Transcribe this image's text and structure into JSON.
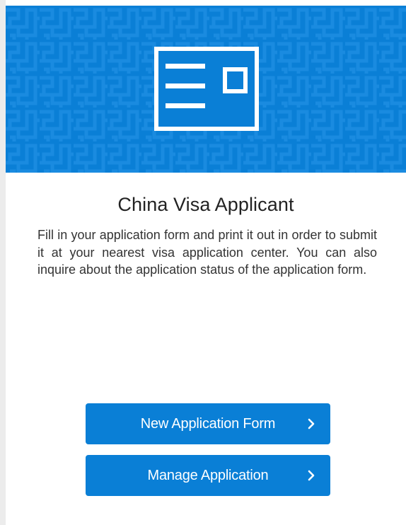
{
  "header": {
    "icon": "id-card-icon",
    "background_color": "#0a7fd6"
  },
  "main": {
    "title": "China Visa Applicant",
    "description": "Fill in your application form and print it out in order to submit it at your nearest visa application center. You can also inquire about the application status of the application form."
  },
  "actions": {
    "new_application_label": "New Application Form",
    "manage_application_label": "Manage Application",
    "chevron_icon": "chevron-right-icon",
    "button_color": "#0a7fd6"
  }
}
